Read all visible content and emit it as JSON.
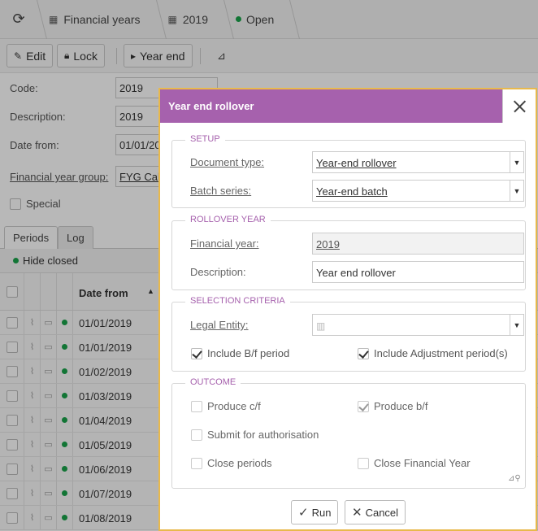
{
  "breadcrumb": {
    "items": [
      {
        "icon": "calendar-icon",
        "label": "Financial years"
      },
      {
        "icon": "calendar-icon",
        "label": "2019"
      },
      {
        "icon": "status-dot",
        "label": "Open"
      }
    ]
  },
  "toolbar": {
    "edit_label": "Edit",
    "lock_label": "Lock",
    "year_end_label": "Year end"
  },
  "form": {
    "code_label": "Code:",
    "code_value": "2019",
    "description_label": "Description:",
    "description_value": "2019",
    "date_from_label": "Date from:",
    "date_from_value": "01/01/20",
    "group_label": "Financial year group:",
    "group_value": "FYG Cale",
    "special_label": "Special"
  },
  "tabs": [
    "Periods",
    "Log"
  ],
  "hide_closed_label": "Hide closed",
  "table": {
    "date_header": "Date from",
    "rows": [
      "01/01/2019",
      "01/01/2019",
      "01/02/2019",
      "01/03/2019",
      "01/04/2019",
      "01/05/2019",
      "01/06/2019",
      "01/07/2019",
      "01/08/2019"
    ]
  },
  "modal": {
    "title": "Year end rollover",
    "setup": {
      "title": "SETUP",
      "doc_type_label": "Document type:",
      "doc_type_value": "Year-end rollover",
      "batch_label": "Batch series:",
      "batch_value": "Year-end batch"
    },
    "rollover": {
      "title": "ROLLOVER YEAR",
      "fin_year_label": "Financial year:",
      "fin_year_value": "2019",
      "desc_label": "Description:",
      "desc_value": "Year end rollover"
    },
    "selection": {
      "title": "SELECTION CRITERIA",
      "legal_entity_label": "Legal Entity:",
      "legal_entity_value": "",
      "include_bf_label": "Include B/f period",
      "include_adj_label": "Include Adjustment period(s)"
    },
    "outcome": {
      "title": "OUTCOME",
      "produce_cf_label": "Produce c/f",
      "produce_bf_label": "Produce b/f",
      "submit_label": "Submit for authorisation",
      "close_periods_label": "Close periods",
      "close_fy_label": "Close Financial Year"
    },
    "run_label": "Run",
    "cancel_label": "Cancel"
  },
  "colors": {
    "modal_header": "#a661ad",
    "modal_border": "#e8b94c",
    "status_green": "#1aa34a"
  }
}
